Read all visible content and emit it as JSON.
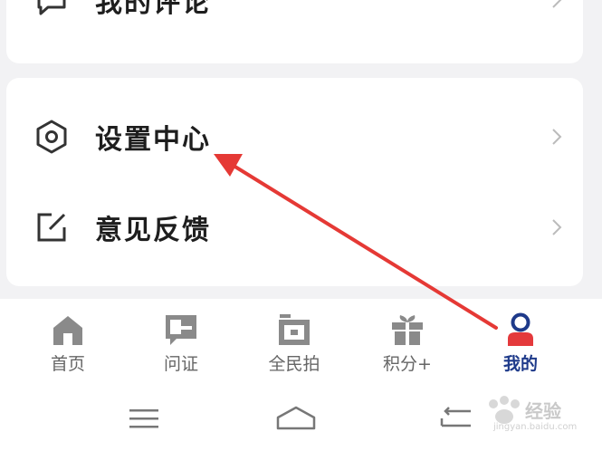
{
  "menu": {
    "top_item": {
      "label": "我的评论",
      "icon": "comment-icon"
    },
    "items": [
      {
        "label": "设置中心",
        "icon": "settings-hexagon-icon"
      },
      {
        "label": "意见反馈",
        "icon": "feedback-edit-icon"
      }
    ]
  },
  "tabbar": {
    "tabs": [
      {
        "label": "首页",
        "icon": "home-icon"
      },
      {
        "label": "问证",
        "icon": "question-icon"
      },
      {
        "label": "全民拍",
        "icon": "camera-icon"
      },
      {
        "label": "积分+",
        "icon": "gift-icon"
      },
      {
        "label": "我的",
        "icon": "user-icon",
        "active": true
      }
    ],
    "active_color": "#1e3a8a",
    "accent_red": "#e4393c"
  },
  "watermark": {
    "text": "经验",
    "url_text": "jingyan.baidu.com"
  },
  "annotation": {
    "color": "#e53935"
  }
}
